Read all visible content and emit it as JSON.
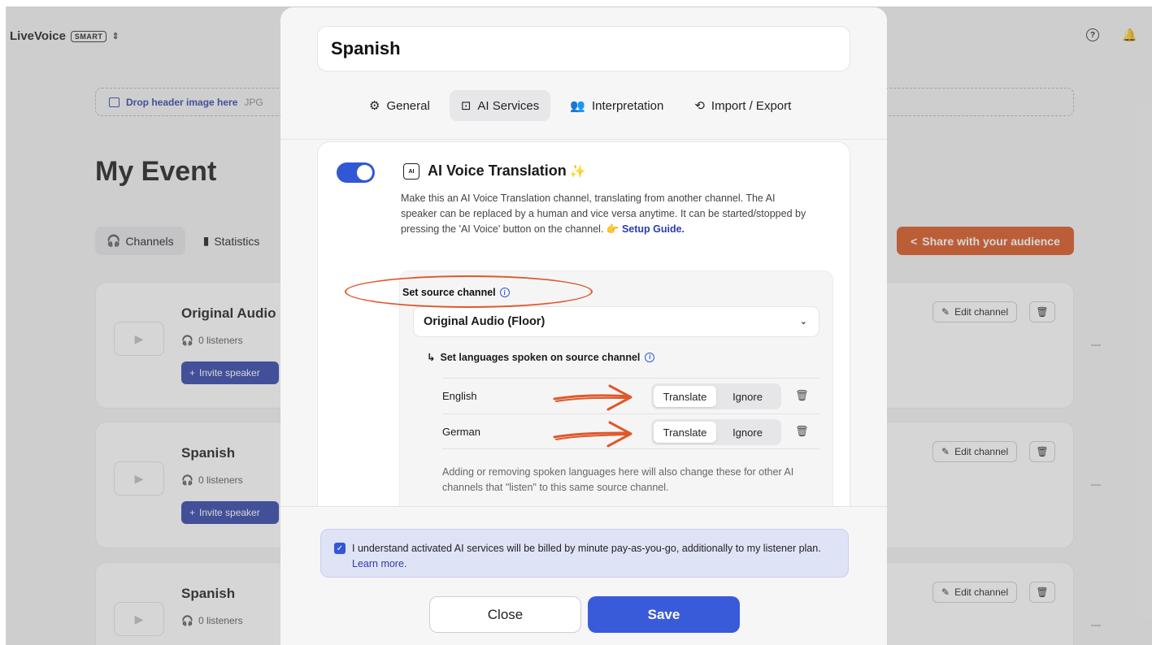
{
  "app": {
    "name": "LiveVoice",
    "plan_badge": "SMART"
  },
  "header_icons": {
    "help": "help-icon",
    "notifications": "bell-icon"
  },
  "event": {
    "dropzone_label": "Drop header image here",
    "dropzone_hint": "JPG",
    "title": "My Event",
    "tabs": [
      {
        "label": "Channels",
        "icon": "headphones-icon"
      },
      {
        "label": "Statistics",
        "icon": "bar-chart-icon"
      }
    ],
    "share_label": "Share with your audience"
  },
  "channels": [
    {
      "name": "Original Audio",
      "listeners": "0 listeners",
      "invite_label": "Invite speaker",
      "edit_label": "Edit channel"
    },
    {
      "name": "Spanish",
      "listeners": "0 listeners",
      "invite_label": "Invite speaker",
      "edit_label": "Edit channel"
    },
    {
      "name": "Spanish",
      "listeners": "0 listeners",
      "edit_label": "Edit channel"
    }
  ],
  "modal": {
    "channel_name": "Spanish",
    "tabs": [
      {
        "label": "General",
        "icon": "gear-icon"
      },
      {
        "label": "AI Services",
        "icon": "chip-icon",
        "active": true
      },
      {
        "label": "Interpretation",
        "icon": "people-icon"
      },
      {
        "label": "Import / Export",
        "icon": "sync-icon"
      }
    ],
    "ai_voice": {
      "enabled": true,
      "title": "AI Voice Translation",
      "description": "Make this an AI Voice Translation channel, translating from another channel. The AI speaker can be replaced by a human and vice versa anytime. It can be started/stopped by pressing the 'AI Voice' button on the channel.",
      "setup_link": "Setup Guide.",
      "source_label": "Set source channel",
      "source_value": "Original Audio (Floor)",
      "languages_label": "Set languages spoken on source channel",
      "languages": [
        {
          "name": "English",
          "options": [
            "Translate",
            "Ignore"
          ],
          "selected": "Translate"
        },
        {
          "name": "German",
          "options": [
            "Translate",
            "Ignore"
          ],
          "selected": "Translate"
        }
      ],
      "note": "Adding or removing spoken languages here will also change these for other AI channels that \"listen\" to this same source channel."
    },
    "consent_text": "I understand activated AI services will be billed by minute pay-as-you-go, additionally to my listener plan.",
    "consent_link": "Learn more.",
    "consent_checked": true,
    "close_label": "Close",
    "save_label": "Save"
  },
  "colors": {
    "accent": "#3257d6",
    "share": "#d9531e",
    "annotation": "#e0582a"
  }
}
